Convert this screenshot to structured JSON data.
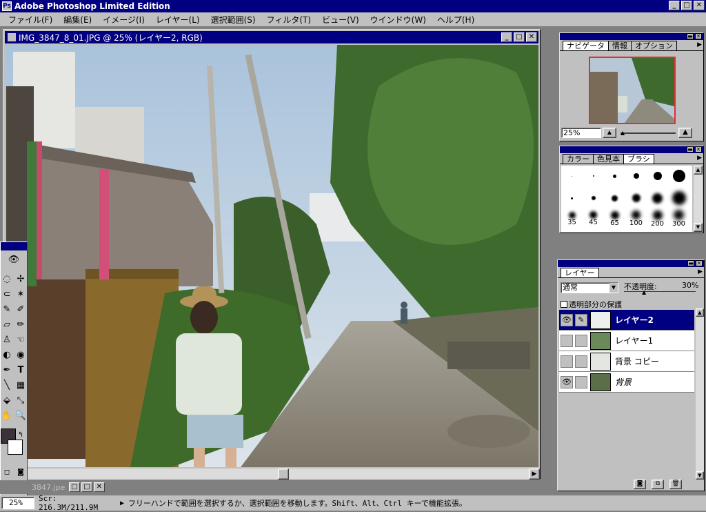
{
  "app": {
    "title": "Adobe Photoshop Limited Edition",
    "icon": "photoshop-icon"
  },
  "window_controls": {
    "minimize": "_",
    "maximize": "□",
    "close": "✕"
  },
  "menu": [
    "ファイル(F)",
    "編集(E)",
    "イメージ(I)",
    "レイヤー(L)",
    "選択範囲(S)",
    "フィルタ(T)",
    "ビュー(V)",
    "ウインドウ(W)",
    "ヘルプ(H)"
  ],
  "document": {
    "title": "IMG_3847_8_01.JPG @ 25% (レイヤー2, RGB)",
    "scroll_arrow": "▶",
    "scroll_position": 0.52
  },
  "minimized_doc": {
    "title": "3847.jpe"
  },
  "status": {
    "zoom": "25%",
    "scratch": "Scr: 216.3M/211.9M",
    "arrow": "▶",
    "hint": "フリーハンドで範囲を選択するか、選択範囲を移動します。Shift、Alt、Ctrl キーで機能拡張。"
  },
  "navigator": {
    "tabs": [
      "ナビゲータ",
      "情報",
      "オプション"
    ],
    "zoom": "25%"
  },
  "brushes": {
    "tabs": [
      "カラー",
      "色見本",
      "ブラシ"
    ],
    "sizes": [
      "35",
      "45",
      "65",
      "100",
      "200",
      "300"
    ]
  },
  "layers": {
    "tab": "レイヤー",
    "blend_mode": "通常",
    "opacity_label": "不透明度:",
    "opacity_value": "30%",
    "preserve_label": "透明部分の保護",
    "items": [
      {
        "name": "レイヤー2",
        "visible": true,
        "active": true
      },
      {
        "name": "レイヤー1",
        "visible": false,
        "active": false
      },
      {
        "name": "背景 コピー",
        "visible": false,
        "active": false
      },
      {
        "name": "背景",
        "visible": true,
        "active": false
      }
    ]
  },
  "colors": {
    "titlebar": "#000080",
    "chrome": "#c0c0c0",
    "workspace": "#808080"
  }
}
